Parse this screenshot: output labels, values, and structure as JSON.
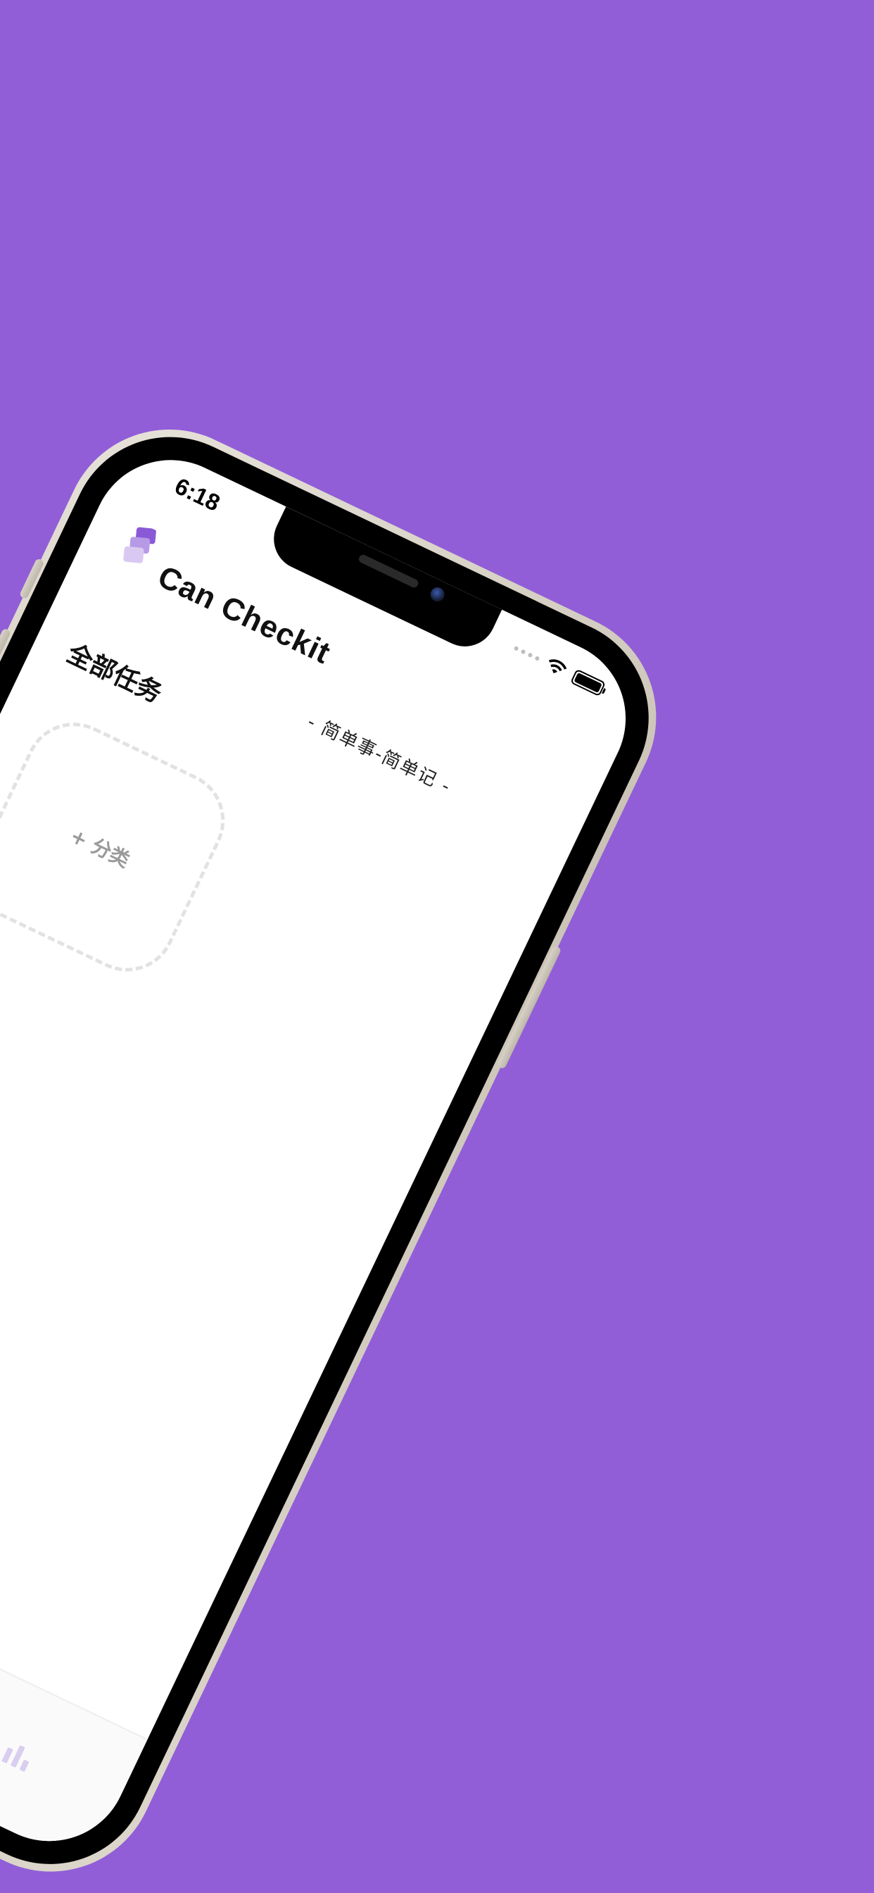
{
  "status_bar": {
    "time": "6:18"
  },
  "app": {
    "title": "Can Checkit",
    "tagline": "- 简单事-简单记 -"
  },
  "main": {
    "section_title": "全部任务",
    "add_category_label": "+ 分类"
  },
  "tabbar": {
    "add_button_label": "+",
    "stats_icon": "bar-chart-icon"
  },
  "colors": {
    "background": "#915ed8",
    "accent": "#8a5ad6",
    "fab": "#000000"
  }
}
